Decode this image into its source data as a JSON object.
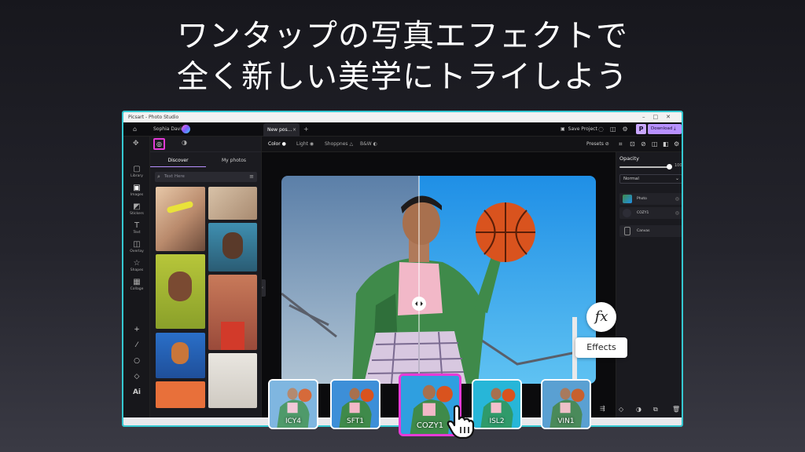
{
  "headline": {
    "line1": "ワンタップの写真エフェクトで",
    "line2": "全く新しい美学にトライしよう"
  },
  "window": {
    "title": "Picsart - Photo Studio",
    "controls": "–□✕",
    "accent": "#35c9d2"
  },
  "topbar": {
    "user_name": "Sophia Davis",
    "tab_label": "New pos...",
    "tab_close": "×",
    "new_tab": "+",
    "save_label": "Save Project",
    "plan_badge": "P",
    "download_label": "Download"
  },
  "rail": {
    "items": [
      {
        "label": "Library",
        "icon": "folder-icon",
        "glyph": "▢"
      },
      {
        "label": "Images",
        "icon": "image-icon",
        "glyph": "▣"
      },
      {
        "label": "Stickers",
        "icon": "sticker-icon",
        "glyph": "◩"
      },
      {
        "label": "Text",
        "icon": "text-icon",
        "glyph": "T"
      },
      {
        "label": "Overlay",
        "icon": "overlay-icon",
        "glyph": "◫"
      },
      {
        "label": "Shapes",
        "icon": "star-icon",
        "glyph": "☆"
      },
      {
        "label": "Collage",
        "icon": "collage-icon",
        "glyph": "▦"
      }
    ],
    "tools": [
      "+",
      "⁄",
      "○",
      "◇",
      "Ai"
    ]
  },
  "library": {
    "tabs": [
      "Discover",
      "My photos"
    ],
    "search_placeholder": "Text Here"
  },
  "options": {
    "items": [
      "Color",
      "Light",
      "Shoppnes",
      "B&W"
    ],
    "presets_label": "Presets"
  },
  "properties": {
    "opacity_label": "Opacity",
    "opacity_value": 100,
    "blend_mode": "Normal",
    "layers": [
      "Photo",
      "COZY1",
      "Canvas"
    ]
  },
  "effects": {
    "button_glyph": "fx",
    "label": "Effects",
    "items": [
      {
        "name": "ICY4",
        "selected": false
      },
      {
        "name": "SFT1",
        "selected": false
      },
      {
        "name": "COZY1",
        "selected": true
      },
      {
        "name": "ISL2",
        "selected": false
      },
      {
        "name": "VIN1",
        "selected": false
      }
    ],
    "selected_color": "#e73ad7"
  }
}
